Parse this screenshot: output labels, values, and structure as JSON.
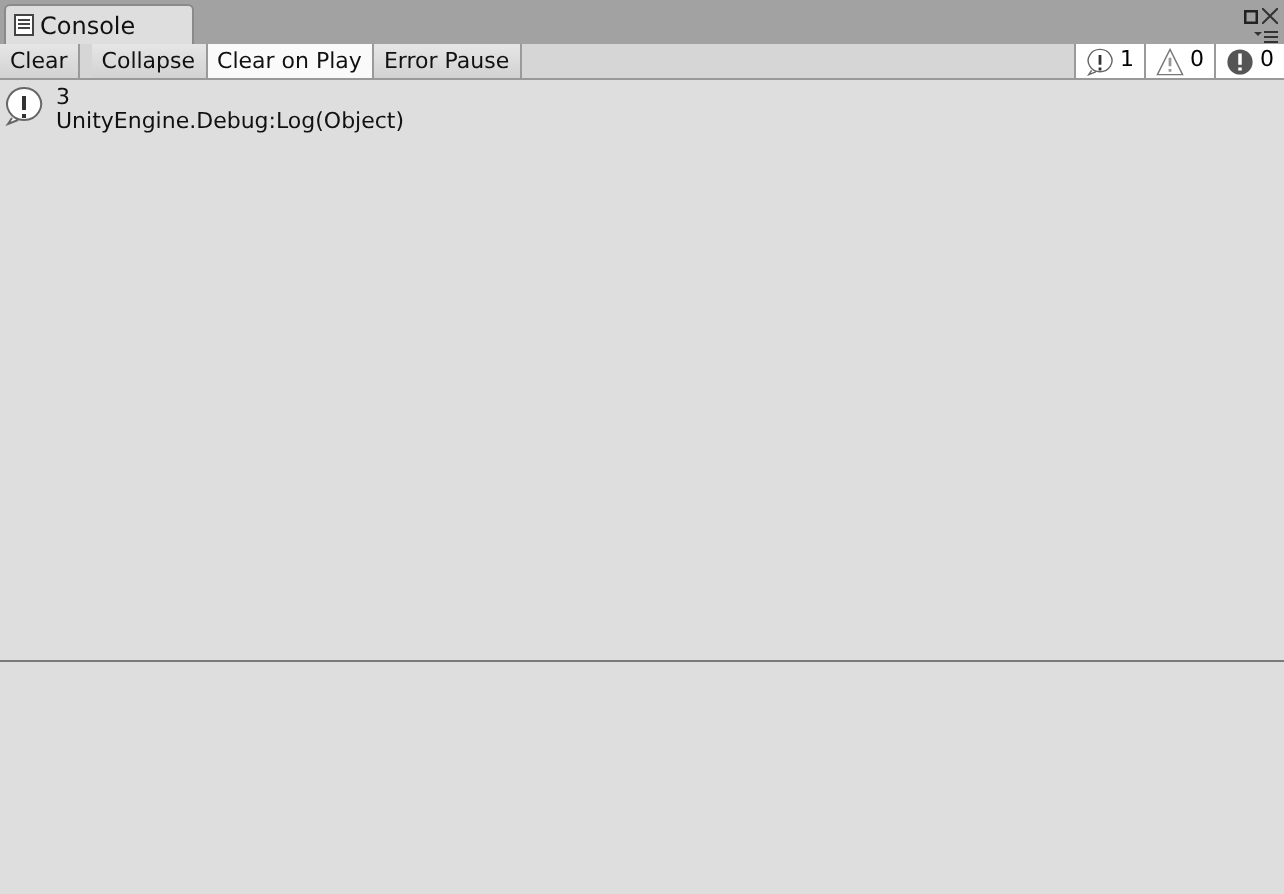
{
  "window": {
    "title": "Console"
  },
  "toolbar": {
    "buttons": [
      {
        "label": "Clear",
        "selected": false
      },
      {
        "label": "Collapse",
        "selected": false
      },
      {
        "label": "Clear on Play",
        "selected": true
      },
      {
        "label": "Error Pause",
        "selected": false
      }
    ],
    "counters": [
      {
        "kind": "info",
        "count": "1",
        "selected": true
      },
      {
        "kind": "warning",
        "count": "0",
        "selected": true
      },
      {
        "kind": "error",
        "count": "0",
        "selected": true
      }
    ]
  },
  "log": [
    {
      "kind": "info",
      "message": "3",
      "trace": "UnityEngine.Debug:Log(Object)"
    }
  ]
}
